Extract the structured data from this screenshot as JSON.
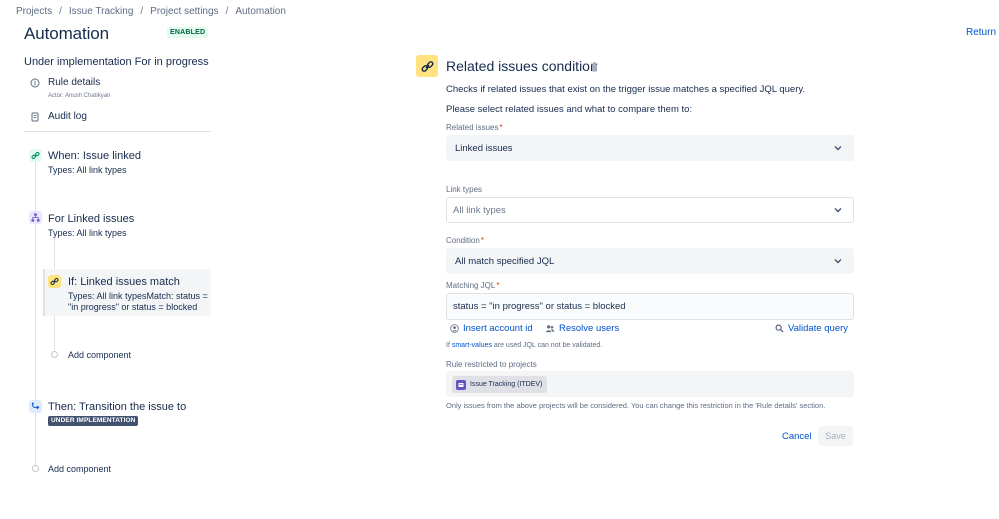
{
  "breadcrumbs": [
    {
      "label": "Projects"
    },
    {
      "label": "Issue Tracking"
    },
    {
      "label": "Project settings"
    },
    {
      "label": "Automation"
    }
  ],
  "breadcrumb_separator": "/",
  "header": {
    "title": "Automation",
    "status_badge": "ENABLED",
    "return_link": "Return t"
  },
  "sidebar": {
    "rule_name": "Under implementation For in progress",
    "rule_details": {
      "label": "Rule details",
      "actor": "Actor: Anush Chatikyan",
      "icon": "info-icon"
    },
    "audit_log": {
      "label": "Audit log",
      "icon": "document-icon"
    },
    "flow": {
      "trigger": {
        "title": "When: Issue linked",
        "subtitle": "Types: All link types",
        "icon": "link-icon"
      },
      "branch": {
        "title": "For Linked issues",
        "subtitle": "Types: All link types",
        "icon": "branch-icon"
      },
      "condition": {
        "title": "If: Linked issues match",
        "subtitle": "Types: All link typesMatch: status = \"in progress\" or status = blocked",
        "icon": "link-icon"
      },
      "branch_add_component": "Add component",
      "action": {
        "title": "Then: Transition the issue to",
        "status_pill": "UNDER IMPLEMENTATION",
        "icon": "transition-icon"
      },
      "add_component": "Add component"
    }
  },
  "panel": {
    "title": "Related issues condition",
    "description": "Checks if related issues that exist on the trigger issue matches a specified JQL query.",
    "instruction": "Please select related issues and what to compare them to:",
    "related_issues": {
      "label": "Related issues",
      "required": "*",
      "value": "Linked issues"
    },
    "link_types": {
      "label": "Link types",
      "placeholder": "All link types"
    },
    "condition": {
      "label": "Condition",
      "required": "*",
      "value": "All match specified JQL"
    },
    "matching_jql": {
      "label": "Matching JQL",
      "required": "*",
      "value": "status = \"in progress\" or status = blocked"
    },
    "insert_account_id": "Insert account id",
    "resolve_users": "Resolve users",
    "validate_query": "Validate query",
    "hint_prefix": "If ",
    "hint_link": "smart-values",
    "hint_suffix": " are used JQL can not be validated.",
    "restricted_label": "Rule restricted to projects",
    "project_chip": "Issue Tracking (ITDEV)",
    "footnote": "Only issues from the above projects will be considered. You can change this restriction in the 'Rule details' section.",
    "cancel_label": "Cancel",
    "save_label": "Save"
  },
  "colors": {
    "accent": "#0052cc",
    "enabled_green": "#006644",
    "enabled_bg": "#e3fcef",
    "panel_icon_bg": "#ffe380",
    "status_pill_bg": "#42526e",
    "required": "#de350b"
  }
}
